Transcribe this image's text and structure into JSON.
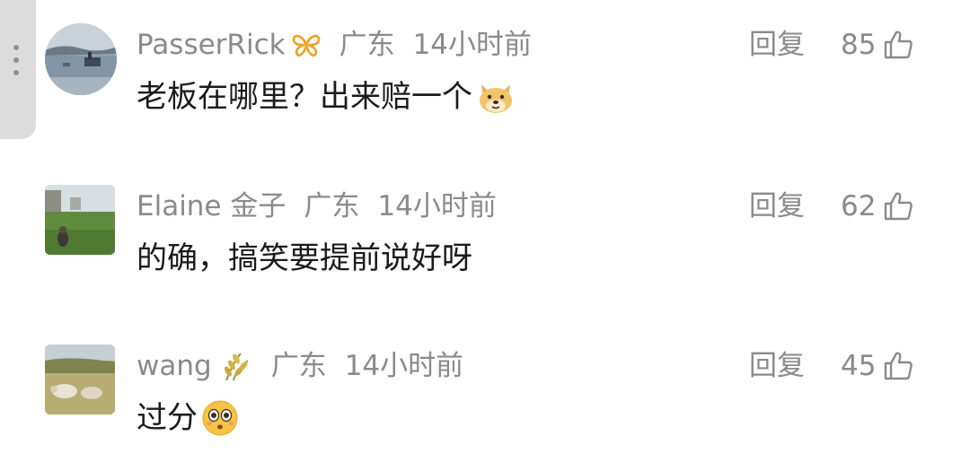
{
  "comments": [
    {
      "username": "PasserRick",
      "badge": "vip-butterfly-icon",
      "location": "广东",
      "time": "14小时前",
      "text": "老板在哪里？出来赔一个",
      "emoji": "doge-emoji",
      "reply_label": "回复",
      "likes": "85"
    },
    {
      "username": "Elaine 金子",
      "location": "广东",
      "time": "14小时前",
      "text": "的确，搞笑要提前说好呀",
      "reply_label": "回复",
      "likes": "62"
    },
    {
      "username": "wang",
      "badge": "wheat-icon",
      "location": "广东",
      "time": "14小时前",
      "text": "过分",
      "emoji": "shocked-face-emoji",
      "reply_label": "回复",
      "likes": "45"
    }
  ],
  "colors": {
    "meta_text": "#8a8a8a",
    "body_text": "#1a1a1a",
    "badge_orange": "#f0a020",
    "handle_bg": "#dcdcdc"
  }
}
